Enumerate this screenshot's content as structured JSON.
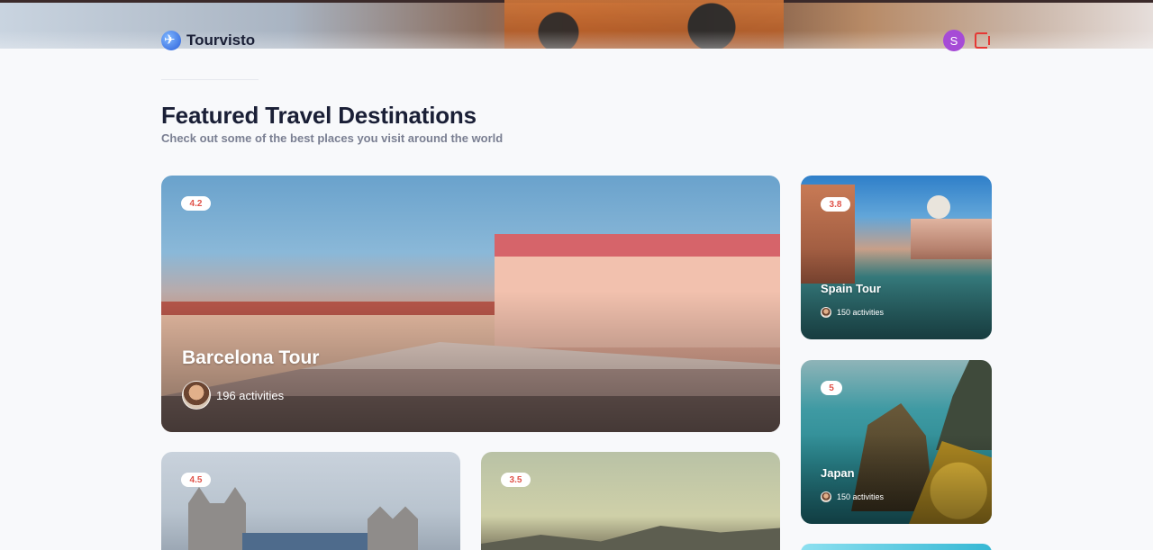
{
  "brand": {
    "name": "Tourvisto"
  },
  "user": {
    "initial": "S"
  },
  "header": {
    "title": "Featured Travel Destinations",
    "subtitle": "Check out some of the best places you visit around the world"
  },
  "cards": {
    "featured": {
      "rating": "4.2",
      "title": "Barcelona Tour",
      "activities": "196 activities"
    },
    "side1": {
      "rating": "3.8",
      "title": "Spain Tour",
      "activities": "150 activities"
    },
    "side2": {
      "rating": "5",
      "title": "Japan",
      "activities": "150 activities"
    },
    "bottom1": {
      "rating": "4.5"
    },
    "bottom2": {
      "rating": "3.5"
    }
  },
  "icons": {
    "logo": "airplane-globe-icon",
    "logout": "logout-icon"
  },
  "colors": {
    "rating_text": "#e0534a",
    "avatar_bg": "#a64bd6",
    "logout": "#e53935",
    "title": "#1a1f36"
  }
}
